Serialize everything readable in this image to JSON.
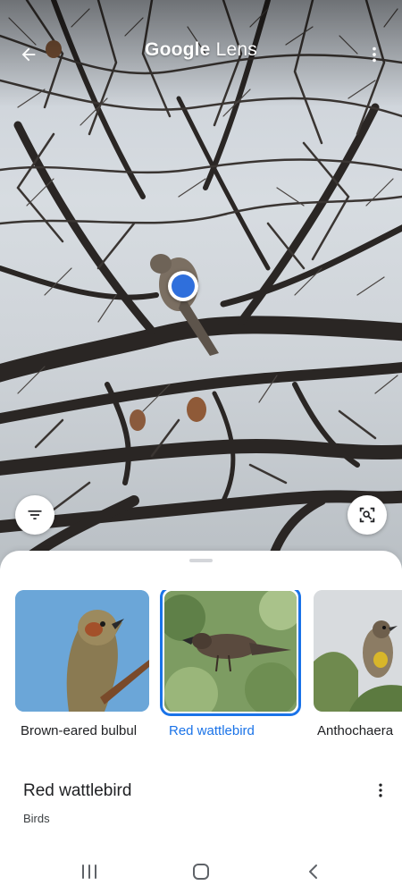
{
  "app": {
    "title_google": "Google",
    "title_lens": "Lens"
  },
  "icons": {
    "back": "arrow-left-icon",
    "more": "more-vert-icon",
    "filter": "filter-icon",
    "select": "region-search-icon",
    "nav_recent": "recent-apps-icon",
    "nav_home": "home-icon",
    "nav_back": "chevron-left-icon"
  },
  "colors": {
    "accent": "#1a73e8",
    "marker": "#2f6fdc"
  },
  "matches": [
    {
      "label": "Brown-eared bulbul",
      "selected": false
    },
    {
      "label": "Red wattlebird",
      "selected": true
    },
    {
      "label": "Anthochaera",
      "selected": false
    }
  ],
  "result": {
    "title": "Red wattlebird",
    "subtitle": "Birds"
  }
}
